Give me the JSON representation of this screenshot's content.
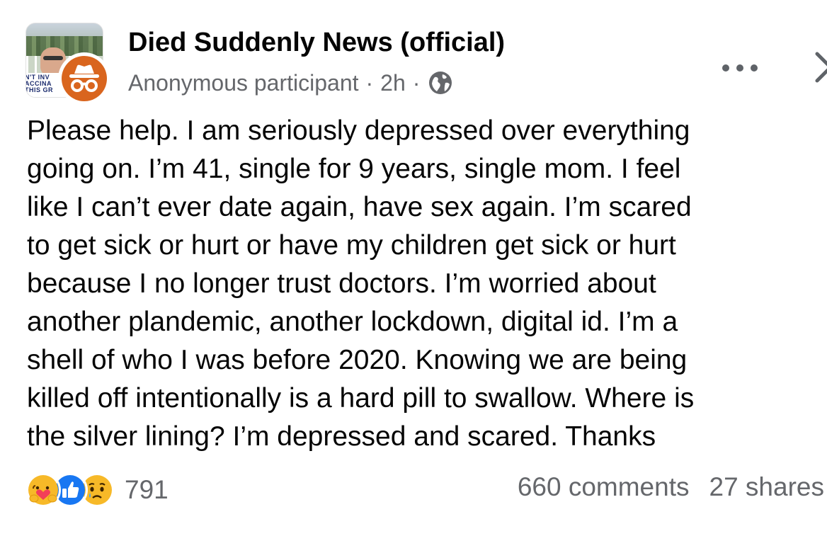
{
  "post": {
    "group_name": "Died Suddenly News (official)",
    "author": "Anonymous participant",
    "separator": "·",
    "timestamp": "2h",
    "audience_icon": "globe-icon",
    "group_avatar_text": "N'T INV\nACCINA\nTHIS GR",
    "badge_icon": "incognito-icon",
    "badge_color": "#d9651e",
    "text_lines": [
      "Please help. I am seriously depressed over everything",
      "going on. I’m 41, single for 9 years, single mom. I feel",
      "like I can’t ever date again, have sex again. I’m scared",
      "to get sick or hurt or have my children get sick or hurt",
      "because I no longer trust doctors. I’m worried about",
      "another plandemic, another lockdown, digital id. I’m a",
      "shell of who I was before 2020. Knowing we are being",
      "killed off intentionally is a hard pill to swallow. Where is",
      "the silver lining? I’m depressed and scared. Thanks"
    ]
  },
  "header_actions": {
    "more_icon": "more-dots-icon",
    "close_icon": "close-icon"
  },
  "engagement": {
    "reactions": [
      "care-reaction-icon",
      "like-reaction-icon",
      "sad-reaction-icon"
    ],
    "reaction_count": "791",
    "comments": "660 comments",
    "shares": "27 shares"
  },
  "colors": {
    "text": "#050505",
    "secondary": "#65676b",
    "like_blue": "#1877f2"
  }
}
